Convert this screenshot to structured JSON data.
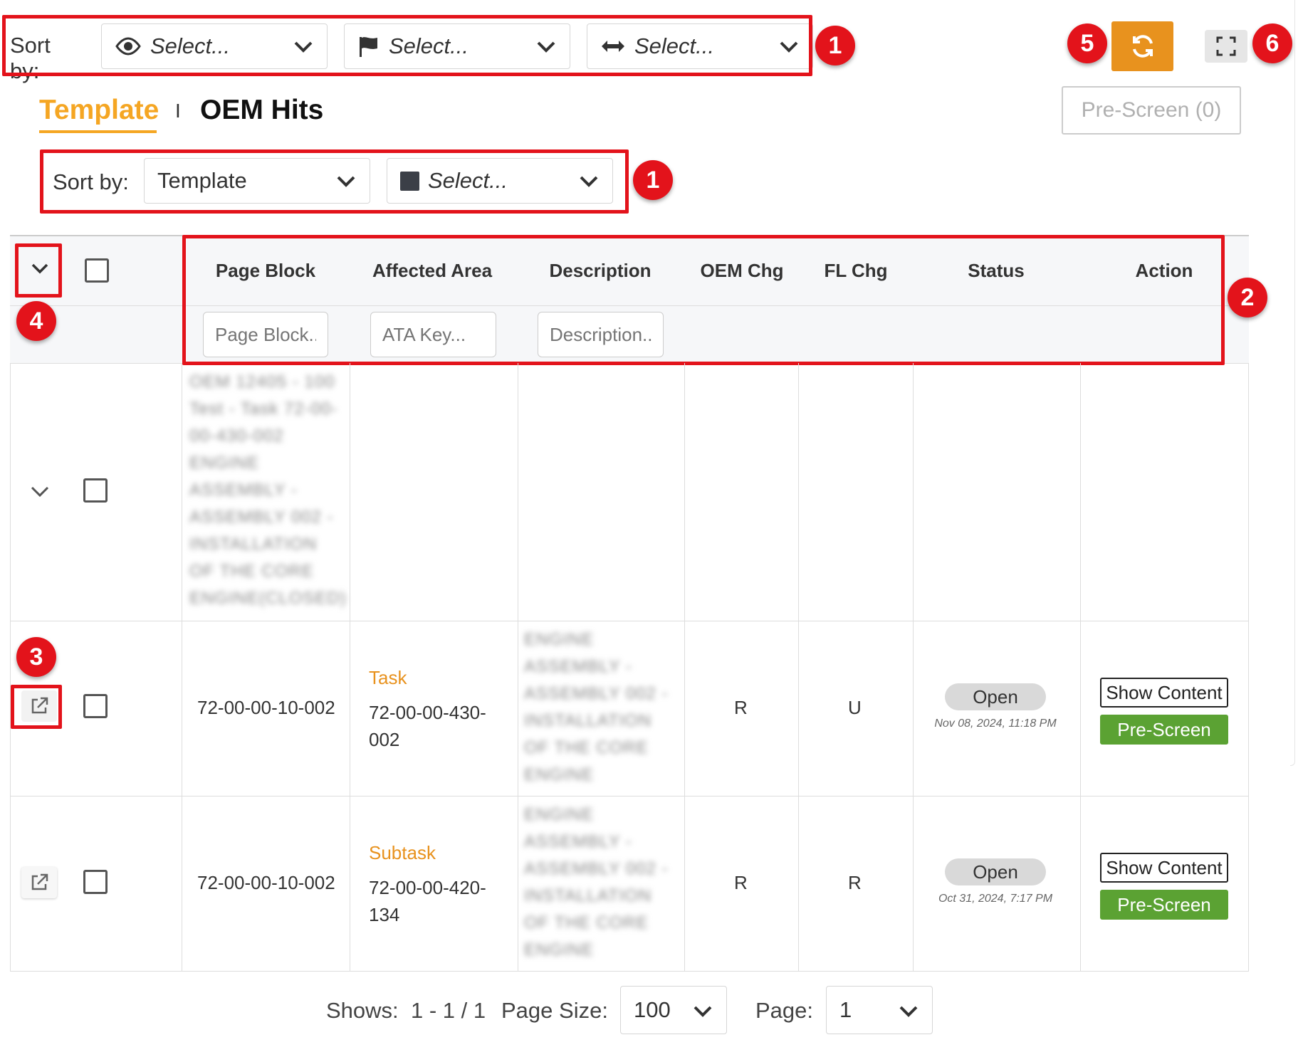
{
  "top_sort": {
    "label": "Sort by:",
    "selects": [
      {
        "icon": "eye-icon",
        "placeholder": "Select..."
      },
      {
        "icon": "flag-icon",
        "placeholder": "Select..."
      },
      {
        "icon": "arrows-horizontal-icon",
        "placeholder": "Select..."
      }
    ]
  },
  "tabs": [
    {
      "label": "Template",
      "active": true
    },
    {
      "label": "OEM Hits",
      "active": false
    }
  ],
  "tab_separator": "I",
  "pre_screen_top": "Pre-Screen (0)",
  "sub_sort": {
    "label": "Sort by:",
    "selects": [
      {
        "icon": "",
        "value": "Template"
      },
      {
        "icon": "square-icon",
        "placeholder": "Select..."
      }
    ]
  },
  "columns": [
    "Page Block",
    "Affected Area",
    "Description",
    "OEM Chg",
    "FL Chg",
    "Status",
    "Action"
  ],
  "filters": {
    "page_block": "Page Block..",
    "ata_key": "ATA Key...",
    "description": "Description.."
  },
  "rows": [
    {
      "kind": "group",
      "page_block_blurred": [
        "OEM 12405 - 100",
        "Test - Task 72-00-",
        "00-430-002",
        "ENGINE",
        "ASSEMBLY -",
        "ASSEMBLY 002 -",
        "INSTALLATION",
        "OF THE CORE",
        "ENGINE(CLOSED)"
      ]
    },
    {
      "kind": "item",
      "page_block": "72-00-00-10-002",
      "area_type": "Task",
      "area_code_1": "72-00-00-430-",
      "area_code_2": "002",
      "description_blurred": [
        "ENGINE",
        "ASSEMBLY -",
        "ASSEMBLY 002 -",
        "INSTALLATION",
        "OF THE CORE",
        "ENGINE"
      ],
      "oem_chg": "R",
      "fl_chg": "U",
      "status": "Open",
      "timestamp": "Nov 08, 2024, 11:18 PM",
      "show_content": "Show Content",
      "pre_screen": "Pre-Screen"
    },
    {
      "kind": "item",
      "page_block": "72-00-00-10-002",
      "area_type": "Subtask",
      "area_code_1": "72-00-00-420-",
      "area_code_2": "134",
      "description_blurred": [
        "ENGINE",
        "ASSEMBLY -",
        "ASSEMBLY 002 -",
        "INSTALLATION",
        "OF THE CORE",
        "ENGINE"
      ],
      "oem_chg": "R",
      "fl_chg": "R",
      "status": "Open",
      "timestamp": "Oct 31, 2024, 7:17 PM",
      "show_content": "Show Content",
      "pre_screen": "Pre-Screen"
    }
  ],
  "pagination": {
    "shows_label": "Shows:",
    "shows_value": "1 - 1 / 1",
    "page_size_label": "Page Size:",
    "page_size_value": "100",
    "page_label": "Page:",
    "page_value": "1"
  },
  "annotations": [
    "1",
    "1",
    "2",
    "3",
    "4",
    "5",
    "6"
  ],
  "colors": {
    "accent_orange": "#f5a623",
    "refresh_button": "#e8921e",
    "callout_red": "#e3131b",
    "green": "#5ba233",
    "link_orange": "#e8921e"
  }
}
